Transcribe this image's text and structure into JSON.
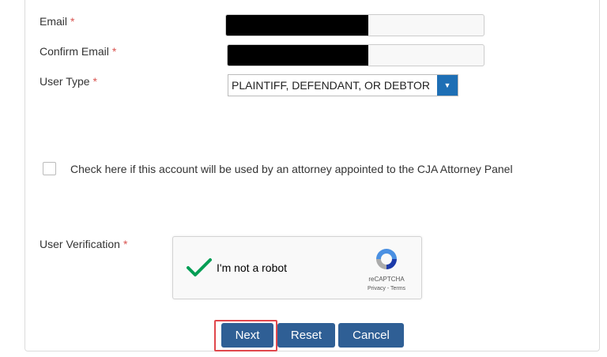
{
  "form": {
    "email": {
      "label": "Email",
      "required": "*"
    },
    "confirm_email": {
      "label": "Confirm Email",
      "required": "*"
    },
    "user_type": {
      "label": "User Type",
      "required": "*",
      "selected": "PLAINTIFF, DEFENDANT, OR DEBTOR"
    },
    "cja_checkbox": {
      "text": "Check here if this account will be used by an attorney appointed to the CJA Attorney Panel",
      "checked": false
    },
    "user_verification": {
      "label": "User Verification",
      "required": "*"
    }
  },
  "captcha": {
    "text": "I'm not a robot",
    "brand": "reCAPTCHA",
    "links": "Privacy - Terms",
    "checked": true,
    "check_color": "#009e55"
  },
  "buttons": {
    "next": "Next",
    "reset": "Reset",
    "cancel": "Cancel"
  },
  "colors": {
    "button": "#2f5f95",
    "highlight": "#e0474c",
    "required": "#d9534f",
    "select_arrow": "#1e6fb5"
  }
}
